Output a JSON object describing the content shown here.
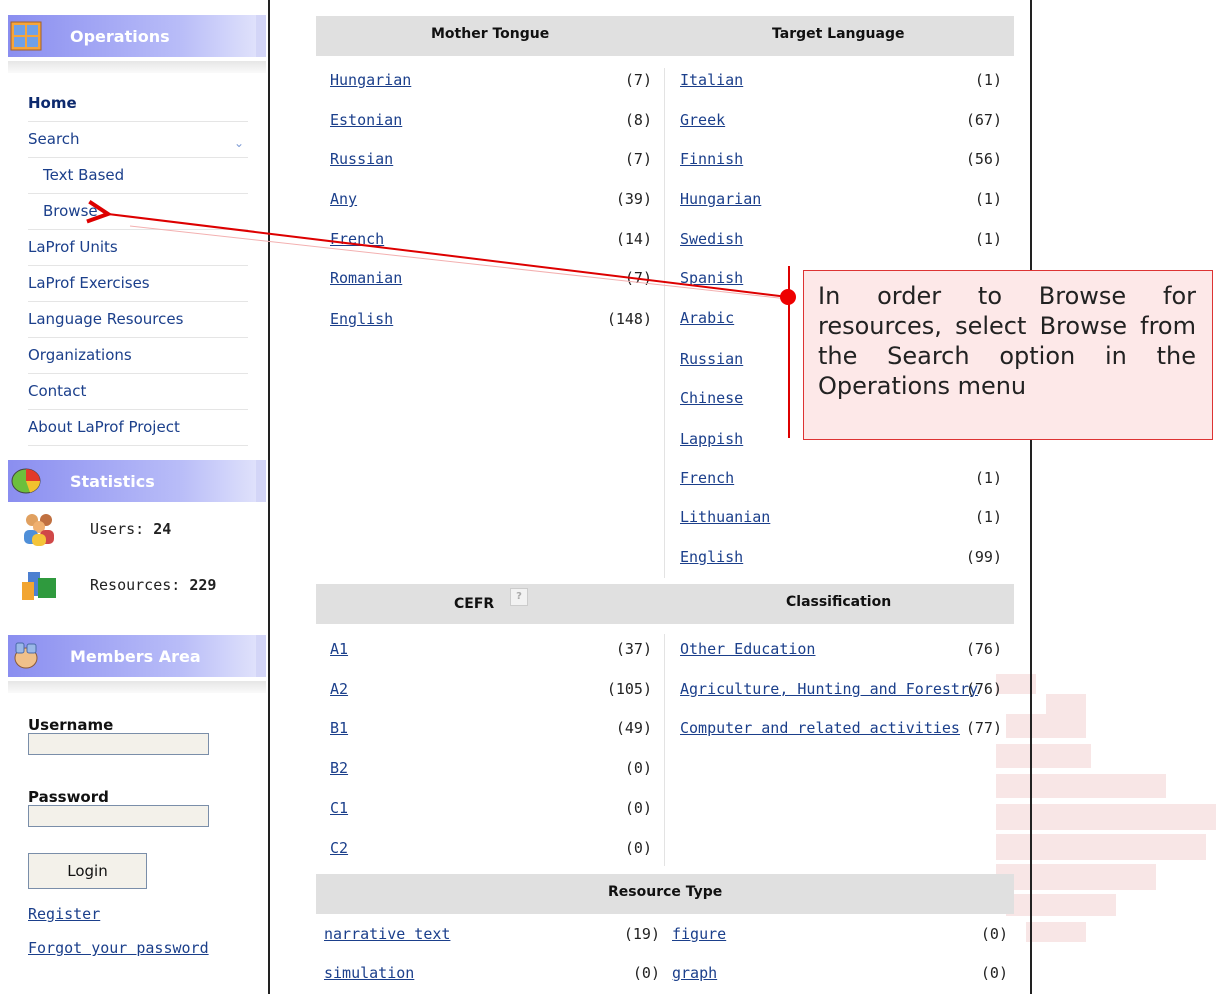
{
  "sidebar": {
    "operations_title": "Operations",
    "statistics_title": "Statistics",
    "members_title": "Members Area",
    "nav": [
      {
        "label": "Home"
      },
      {
        "label": "Search"
      },
      {
        "label": "Text Based"
      },
      {
        "label": "Browse"
      },
      {
        "label": "LaProf Units"
      },
      {
        "label": "LaProf Exercises"
      },
      {
        "label": "Language Resources"
      },
      {
        "label": "Organizations"
      },
      {
        "label": "Contact"
      },
      {
        "label": "About LaProf Project"
      }
    ],
    "stats": {
      "users_label": "Users:",
      "users_value": "24",
      "resources_label": "Resources:",
      "resources_value": "229"
    },
    "login": {
      "username_label": "Username",
      "password_label": "Password",
      "login_button": "Login",
      "register_link": "Register",
      "forgot_link": "Forgot your password"
    }
  },
  "main": {
    "mother_tongue_header": "Mother Tongue",
    "target_language_header": "Target Language",
    "mother_tongue": [
      {
        "label": "Hungarian",
        "count": "(7)"
      },
      {
        "label": "Estonian",
        "count": "(8)"
      },
      {
        "label": "Russian",
        "count": "(7)"
      },
      {
        "label": "Any",
        "count": "(39)"
      },
      {
        "label": "French",
        "count": "(14)"
      },
      {
        "label": "Romanian",
        "count": "(7)"
      },
      {
        "label": "English",
        "count": "(148)"
      }
    ],
    "target_language": [
      {
        "label": "Italian",
        "count": "(1)"
      },
      {
        "label": "Greek",
        "count": "(67)"
      },
      {
        "label": "Finnish",
        "count": "(56)"
      },
      {
        "label": "Hungarian",
        "count": "(1)"
      },
      {
        "label": "Swedish",
        "count": "(1)"
      },
      {
        "label": "Spanish",
        "count": ""
      },
      {
        "label": "Arabic",
        "count": ""
      },
      {
        "label": "Russian",
        "count": ""
      },
      {
        "label": "Chinese",
        "count": ""
      },
      {
        "label": "Lappish",
        "count": ""
      },
      {
        "label": "French",
        "count": "(1)"
      },
      {
        "label": "Lithuanian",
        "count": "(1)"
      },
      {
        "label": "English",
        "count": "(99)"
      }
    ],
    "cefr_header": "CEFR",
    "classification_header": "Classification",
    "cefr": [
      {
        "label": "A1",
        "count": "(37)"
      },
      {
        "label": "A2",
        "count": "(105)"
      },
      {
        "label": "B1",
        "count": "(49)"
      },
      {
        "label": "B2",
        "count": "(0)"
      },
      {
        "label": "C1",
        "count": "(0)"
      },
      {
        "label": "C2",
        "count": "(0)"
      }
    ],
    "classification": [
      {
        "label": "Other Education",
        "count": "(76)"
      },
      {
        "label": "Agriculture, Hunting and Forestry",
        "count": "(76)"
      },
      {
        "label": "Computer and related activities",
        "count": "(77)"
      }
    ],
    "resource_type_header": "Resource Type",
    "resource_type_left": [
      {
        "label": "narrative text",
        "count": "(19)"
      },
      {
        "label": "simulation",
        "count": "(0)"
      }
    ],
    "resource_type_right": [
      {
        "label": "figure",
        "count": "(0)"
      },
      {
        "label": "graph",
        "count": "(0)"
      }
    ],
    "help_glyph": "?"
  },
  "callout": {
    "text": "In order to Browse for resources, select Browse from the Search option in the Operations menu"
  },
  "colors": {
    "header_gradient": "#8a8ef0",
    "link": "#1b3f8b",
    "callout_border": "#d33333",
    "arrow": "#dd0000"
  }
}
